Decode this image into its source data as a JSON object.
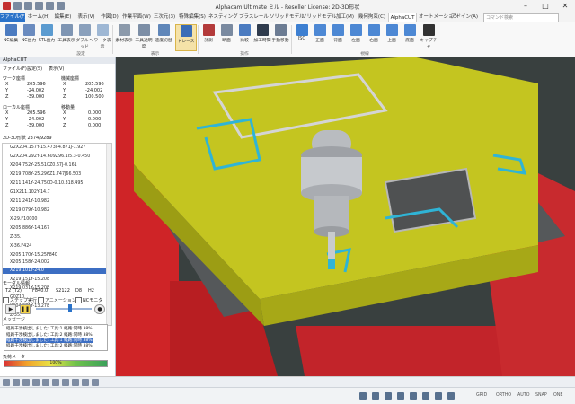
{
  "window": {
    "title": "Alphacam Ultimate ミル - Reseller License: 2D-3D形状",
    "min_glyph": "–",
    "max_glyph": "□",
    "close_glyph": "✕"
  },
  "tabs": [
    {
      "label": "ファイル(F)"
    },
    {
      "label": "ホーム(H)"
    },
    {
      "label": "編集(E)"
    },
    {
      "label": "表示(V)"
    },
    {
      "label": "作図(D)"
    },
    {
      "label": "作業平面(W)"
    },
    {
      "label": "三次元(3)"
    },
    {
      "label": "特殊編集(S)"
    },
    {
      "label": "ネスティング"
    },
    {
      "label": "ブラスレール"
    },
    {
      "label": "ソリッドモデル"
    },
    {
      "label": "ソリッドモデル"
    },
    {
      "label": "加工(M)"
    },
    {
      "label": "幾何拘束(C)"
    },
    {
      "label": "AlphaCUT"
    },
    {
      "label": "オートメーション"
    },
    {
      "label": "アドイン(A)"
    }
  ],
  "search": {
    "placeholder": "コマンド検索"
  },
  "ribbon": {
    "buttons": [
      {
        "label": "NC編集"
      },
      {
        "label": "NC出力"
      },
      {
        "label": "STL出力"
      },
      {
        "label": "工具表示"
      },
      {
        "label": "ダブルヘッド"
      },
      {
        "label": "ワーク表示"
      },
      {
        "label": "素材表示"
      },
      {
        "label": "工具透明度"
      },
      {
        "label": "速度切替"
      },
      {
        "label": "トレース"
      },
      {
        "label": "計測"
      },
      {
        "label": "断面"
      },
      {
        "label": "比較"
      },
      {
        "label": "加工時間"
      },
      {
        "label": "手動移動"
      },
      {
        "label": "ISO"
      },
      {
        "label": "正面"
      },
      {
        "label": "背面"
      },
      {
        "label": "左面"
      },
      {
        "label": "右面"
      },
      {
        "label": "上面"
      },
      {
        "label": "底面"
      },
      {
        "label": "キャプチャ"
      }
    ],
    "groups": [
      {
        "label": "設定"
      },
      {
        "label": "表示"
      },
      {
        "label": "操作"
      },
      {
        "label": "視線"
      }
    ]
  },
  "panel": {
    "title": "AlphaCUT",
    "menu": [
      "ファイル(F)",
      "設定(S)",
      "表示(V)"
    ],
    "work_coords": {
      "label": "ワーク座標",
      "rows": [
        [
          "X",
          "205.596"
        ],
        [
          "Y",
          "-24.002"
        ],
        [
          "Z",
          "-39.000"
        ]
      ]
    },
    "machine_coords": {
      "label": "機械座標",
      "rows": [
        [
          "X",
          "205.596"
        ],
        [
          "Y",
          "-24.002"
        ],
        [
          "Z",
          "100.500"
        ]
      ]
    },
    "local_coords": {
      "label": "ローカル座標",
      "rows": [
        [
          "X",
          "205.596"
        ],
        [
          "Y",
          "-24.002"
        ],
        [
          "Z",
          "-39.000"
        ]
      ]
    },
    "offset_coords": {
      "label": "移動量",
      "rows": [
        [
          "X",
          "0.000"
        ],
        [
          "Y",
          "0.000"
        ],
        [
          "Z",
          "0.000"
        ]
      ]
    },
    "nc_header": "2D-3D形状  2374/9289",
    "nc_lines": [
      "G2X204.157Y-15.473I-4.871J-1.927",
      "G2X204.292Y-14.609Z96.1I5.3-0.450",
      "X204.752Y-25.510Z0.67J-0.161",
      "X219.708Y-25.296Z1.747J66.503",
      "X211.141Y-24.750D-0.10.318.495",
      "G1X211.102Y-14.7",
      "X211.241Y-10.982",
      "X219.079Y-10.982",
      "X-29.F10000",
      "X205.886Y-14.167",
      "Z-35.",
      "X-36.F424",
      "X205.170Y-15.25F840",
      "X205.158Y-24.002",
      "X219.101Y-24.0",
      "X219.151Y-15.208",
      "X219.031Y-15.208",
      "G0Z10.",
      "X204.971Y-13.278",
      "Z-35."
    ],
    "modal_label": "モーダル情報",
    "modal": [
      "T2 (T2)",
      "F840.0",
      "S2122",
      "D8",
      "H2"
    ],
    "checks": [
      {
        "label": "ステップ実行"
      },
      {
        "label": "アニメーション"
      },
      {
        "label": "NCモニタ"
      }
    ],
    "message_label": "メッセージ",
    "messages": [
      "経路干渉検出しました: 工具:1 経路:同時 38%",
      "経路干渉検出しました: 工具:2 経路:同時 38%",
      "経路干渉検出しました: 工具:1 経路:同時 38%",
      "経路干渉検出しました: 工具:2 経路:同時 38%"
    ],
    "load_label": "負荷メータ",
    "load_value": "100%"
  },
  "status": {
    "items": [
      "GRID",
      "ORTHO",
      "AUTO",
      "SNAP",
      "ONE"
    ]
  },
  "colors": {
    "accent": "#2a72c9",
    "part_yellow": "#c4c520",
    "fixture_red": "#cf2427",
    "floor": "#39403f"
  }
}
